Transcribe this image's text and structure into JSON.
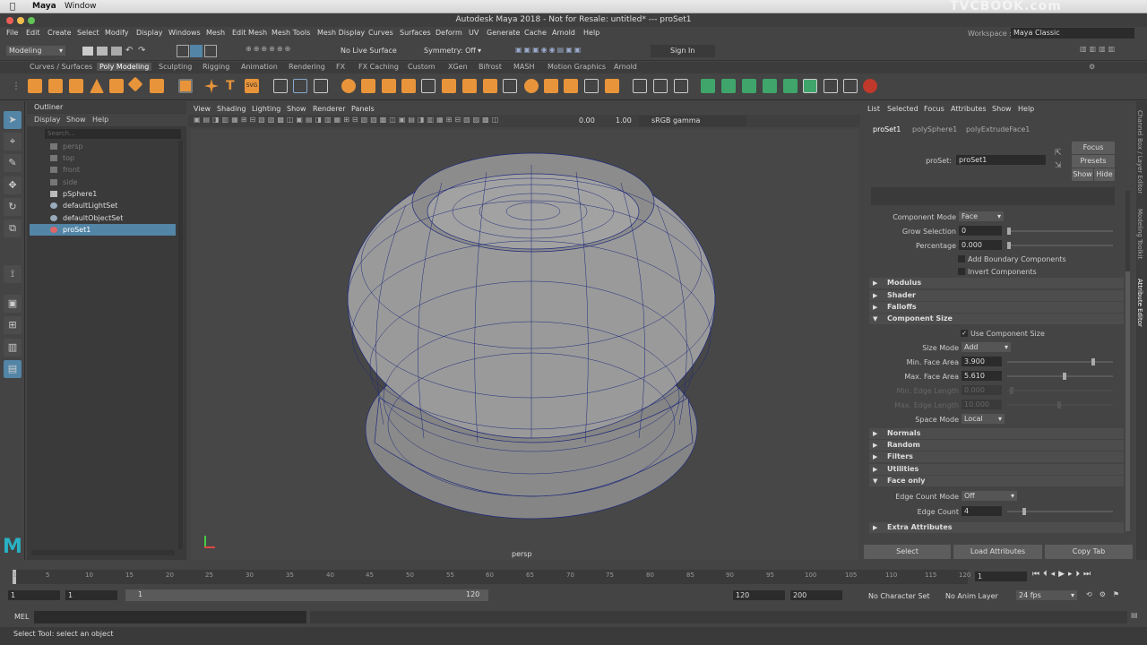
{
  "mac_menu": {
    "app": "Maya",
    "window": "Window",
    "watermark": "TVCBOOK.com"
  },
  "window_title": "Autodesk Maya 2018 - Not for Resale: untitled*  ---  proSet1",
  "workspace": {
    "label": "Workspace :",
    "value": "Maya Classic"
  },
  "main_menu": [
    "File",
    "Edit",
    "Create",
    "Select",
    "Modify",
    "Display",
    "Windows",
    "Mesh",
    "Edit Mesh",
    "Mesh Tools",
    "Mesh Display",
    "Curves",
    "Surfaces",
    "Deform",
    "UV",
    "Generate",
    "Cache",
    "Arnold",
    "Help"
  ],
  "status_line": {
    "mode": "Modeling",
    "live_surface": "No Live Surface",
    "symmetry": "Symmetry: Off",
    "sign_in": "Sign In"
  },
  "shelf_tabs": [
    "Curves / Surfaces",
    "Poly Modeling",
    "Sculpting",
    "Rigging",
    "Animation",
    "Rendering",
    "FX",
    "FX Caching",
    "Custom",
    "XGen",
    "Bifrost",
    "MASH",
    "Motion Graphics",
    "Arnold"
  ],
  "active_shelf": "Poly Modeling",
  "outliner": {
    "title": "Outliner",
    "menu": [
      "Display",
      "Show",
      "Help"
    ],
    "search_placeholder": "Search...",
    "items": [
      {
        "label": "persp",
        "grey": true,
        "icon": "camera-icon"
      },
      {
        "label": "top",
        "grey": true,
        "icon": "camera-icon"
      },
      {
        "label": "front",
        "grey": true,
        "icon": "camera-icon"
      },
      {
        "label": "side",
        "grey": true,
        "icon": "camera-icon"
      },
      {
        "label": "pSphere1",
        "grey": false,
        "icon": "mesh-icon"
      },
      {
        "label": "defaultLightSet",
        "grey": false,
        "icon": "set-icon"
      },
      {
        "label": "defaultObjectSet",
        "grey": false,
        "icon": "set-icon"
      },
      {
        "label": "proSet1",
        "grey": false,
        "icon": "proset-icon",
        "selected": true
      }
    ]
  },
  "viewport": {
    "menu": [
      "View",
      "Shading",
      "Lighting",
      "Show",
      "Renderer",
      "Panels"
    ],
    "exposure": "0.00",
    "gamma": "1.00",
    "color_space": "sRGB gamma",
    "camera_label": "persp"
  },
  "attribute_editor": {
    "menu": [
      "List",
      "Selected",
      "Focus",
      "Attributes",
      "Show",
      "Help"
    ],
    "tabs": [
      "proSet1",
      "polySphere1",
      "polyExtrudeFace1"
    ],
    "proset_label": "proSet:",
    "proset_value": "proSet1",
    "focus": "Focus",
    "presets": "Presets",
    "show": "Show",
    "hide": "Hide",
    "component_mode": {
      "label": "Component Mode",
      "value": "Face"
    },
    "grow_selection": {
      "label": "Grow Selection",
      "value": "0"
    },
    "percentage": {
      "label": "Percentage",
      "value": "0.000"
    },
    "add_boundary": "Add Boundary Components",
    "invert": "Invert Components",
    "sections_top": [
      "Modulus",
      "Shader",
      "Falloffs"
    ],
    "component_size": {
      "title": "Component Size",
      "use_label": "Use Component Size",
      "size_mode": {
        "label": "Size Mode",
        "value": "Add"
      },
      "min_face": {
        "label": "Min. Face Area",
        "value": "3.900"
      },
      "max_face": {
        "label": "Max. Face Area",
        "value": "5.610"
      },
      "min_edge": {
        "label": "Min. Edge Length",
        "value": "0.000"
      },
      "max_edge": {
        "label": "Max. Edge Length",
        "value": "10.000"
      },
      "space_mode": {
        "label": "Space Mode",
        "value": "Local"
      }
    },
    "sections_mid": [
      "Normals",
      "Random",
      "Filters",
      "Utilities"
    ],
    "face_only": {
      "title": "Face only",
      "edge_count_mode": {
        "label": "Edge Count Mode",
        "value": "Off"
      },
      "edge_count": {
        "label": "Edge Count",
        "value": "4"
      }
    },
    "extra": "Extra Attributes",
    "buttons": {
      "select": "Select",
      "load": "Load Attributes",
      "copy": "Copy Tab"
    }
  },
  "side_tabs": [
    "Channel Box / Layer Editor",
    "Modeling Toolkit",
    "Attribute Editor"
  ],
  "timeline": {
    "ticks": [
      "1",
      "5",
      "10",
      "15",
      "20",
      "25",
      "30",
      "35",
      "40",
      "45",
      "50",
      "55",
      "60",
      "65",
      "70",
      "75",
      "80",
      "85",
      "90",
      "95",
      "100",
      "105",
      "110",
      "115",
      "120"
    ],
    "current_frame": "1"
  },
  "range": {
    "start": "1",
    "start2": "1",
    "slider_start": "1",
    "slider_end": "120",
    "end": "120",
    "end2": "200",
    "character": "No Character Set",
    "anim_layer": "No Anim Layer",
    "fps": "24 fps"
  },
  "command_line": {
    "label": "MEL"
  },
  "help_line": "Select Tool: select an object"
}
